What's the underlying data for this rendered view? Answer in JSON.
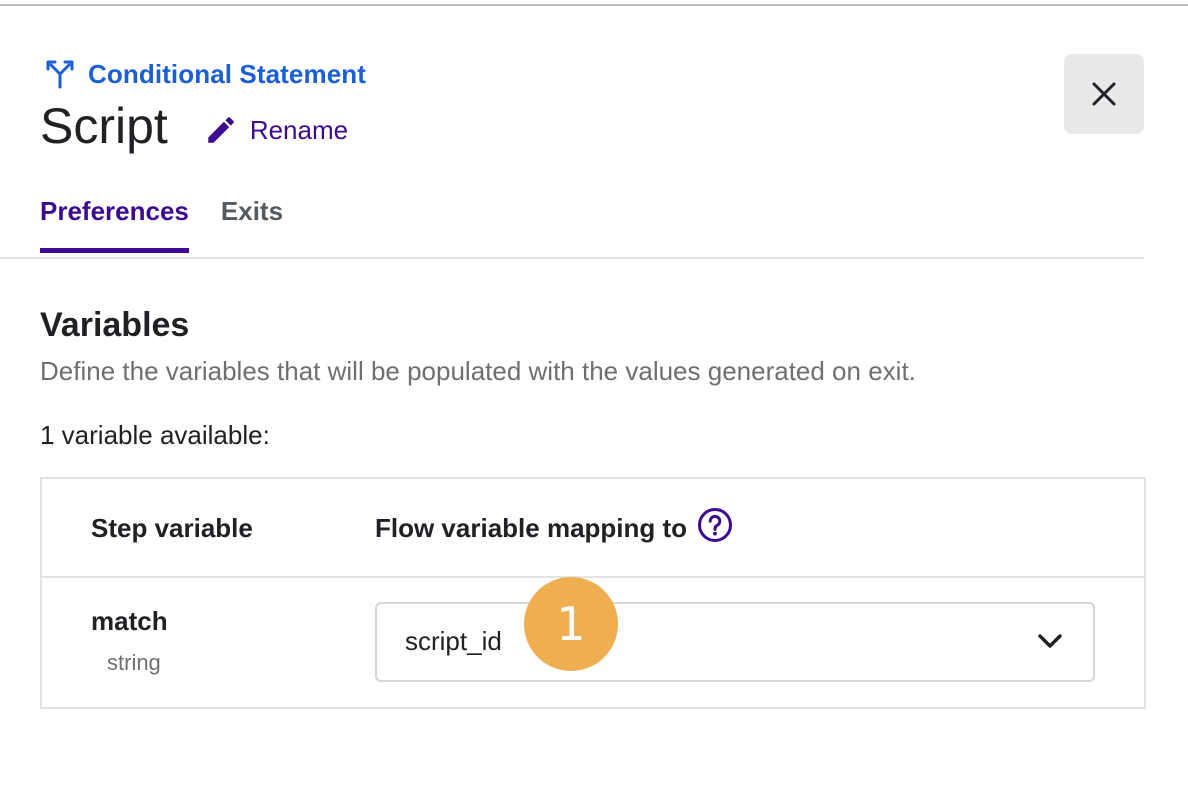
{
  "header": {
    "step_type": "Conditional Statement",
    "step_type_icon": "branch-icon",
    "title": "Script",
    "rename_label": "Rename",
    "rename_icon": "pencil-icon",
    "close_icon": "close-icon"
  },
  "tabs": [
    {
      "label": "Preferences",
      "active": true
    },
    {
      "label": "Exits",
      "active": false
    }
  ],
  "variables_section": {
    "title": "Variables",
    "description": "Define the variables that will be populated with the values generated on exit.",
    "count_text": "1 variable available:",
    "columns": [
      "Step variable",
      "Flow variable mapping to"
    ],
    "help_icon": "help-circle-icon",
    "rows": [
      {
        "name": "match",
        "type": "string",
        "mapping": "script_id"
      }
    ]
  },
  "annotation": {
    "badge": "1"
  },
  "colors": {
    "link_blue": "#1a5fd6",
    "accent_purple": "#3d0a91",
    "badge_orange": "#efae4f"
  }
}
